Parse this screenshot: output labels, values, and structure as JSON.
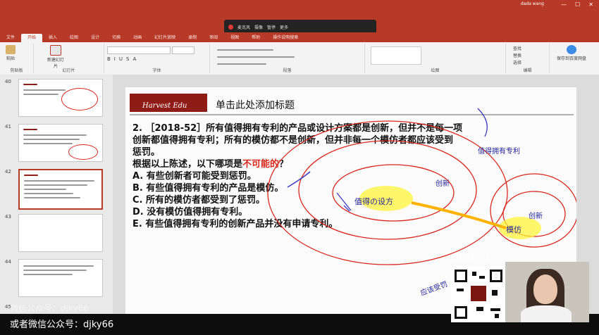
{
  "titlebar": {
    "user": "dada wang",
    "window_controls": [
      "—",
      "☐",
      "✕"
    ]
  },
  "meeting": {
    "items": [
      "麦克风",
      "摄像",
      "暂停",
      "更多"
    ]
  },
  "ribbon_tabs": [
    "文件",
    "开始",
    "插入",
    "绘图",
    "设计",
    "切换",
    "动画",
    "幻灯片放映",
    "录制",
    "审阅",
    "视图",
    "帮助",
    "操作说明搜索"
  ],
  "ribbon": {
    "groups": [
      "剪贴板",
      "幻灯片",
      "字体",
      "段落",
      "绘图",
      "编辑",
      "百度网盘"
    ],
    "paste": "粘贴",
    "new_slide": "新建幻灯片",
    "find": "查找",
    "replace": "替换",
    "select": "选择",
    "save_to_baidu": "保存到百度网盘"
  },
  "slides": [
    {
      "num": "40"
    },
    {
      "num": "41"
    },
    {
      "num": "42"
    },
    {
      "num": "43"
    },
    {
      "num": "44"
    },
    {
      "num": "45"
    }
  ],
  "slide": {
    "logo_text": "Harvest Edu",
    "title": "单击此处添加标题",
    "question_l1": "2. ［2018-52］所有值得拥有专利的产品或设计方案都是创新，但并不是每一项",
    "question_l2": "创新都值得拥有专利；所有的模仿都不是创新，但并非每一个模仿者都应该受到",
    "question_l3": "惩罚。",
    "prompt_a": "根据以上陈述，以下哪项是",
    "prompt_red": "不可能的",
    "prompt_b": "？",
    "options": [
      "A. 有些创新者可能受到惩罚。",
      "B. 有些值得拥有专利的产品是模仿。",
      "C. 所有的模仿者都受到了惩罚。",
      "D. 没有模仿值得拥有专利。",
      "E. 有些值得拥有专利的创新产品并没有申请专利。"
    ],
    "handwriting": {
      "center": "值得の设方",
      "innovation": "创新",
      "patent": "值得拥有专利",
      "imitation": "模仿",
      "lower": "应该受罚"
    }
  },
  "overlay": {
    "wechat_watermark": "微信扫一扫",
    "faded_watermark": "微信公众号：djky66",
    "footer": "或者微信公众号：djky66"
  }
}
